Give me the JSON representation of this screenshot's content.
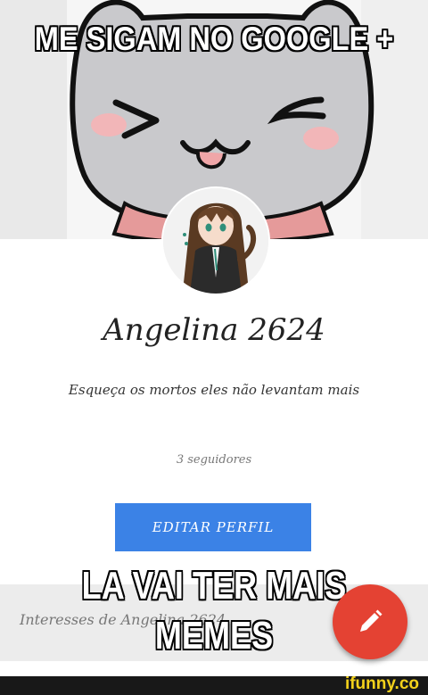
{
  "meme": {
    "top_caption": "ME SIGAM NO GOOGLE +",
    "bottom_caption_line1": "LA VAI TER MAIS",
    "bottom_caption_line2": "MEMES"
  },
  "profile": {
    "name": "Angelina 2624",
    "bio": "Esqueça os mortos eles não levantam mais",
    "followers": "3 seguidores",
    "edit_button_label": "EDITAR PERFIL",
    "interests_label": "Interesses de Angelina 2624"
  },
  "watermark": "ifunny.co",
  "colors": {
    "edit_button": "#3b82e6",
    "fab": "#e44233",
    "watermark": "#f3d11b"
  },
  "icons": {
    "fab": "pencil-icon"
  }
}
